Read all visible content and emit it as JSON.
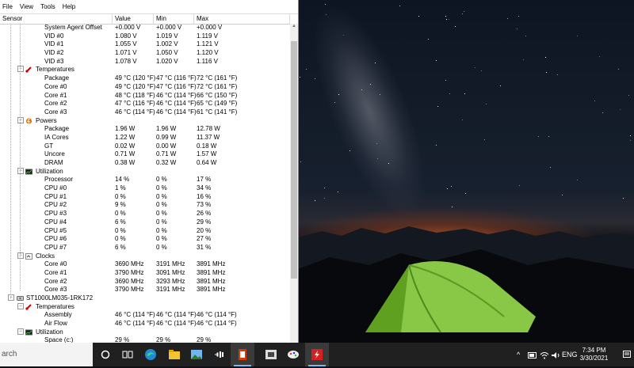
{
  "menu": [
    "File",
    "View",
    "Tools",
    "Help"
  ],
  "columns": {
    "sensor": "Sensor",
    "value": "Value",
    "min": "Min",
    "max": "Max"
  },
  "rows": [
    {
      "type": "item",
      "name": "System Agent Offset",
      "value": "+0.000 V",
      "min": "+0.000 V",
      "max": "+0.000 V"
    },
    {
      "type": "item",
      "name": "VID #0",
      "value": "1.080 V",
      "min": "1.019 V",
      "max": "1.119 V"
    },
    {
      "type": "item",
      "name": "VID #1",
      "value": "1.055 V",
      "min": "1.002 V",
      "max": "1.121 V"
    },
    {
      "type": "item",
      "name": "VID #2",
      "value": "1.071 V",
      "min": "1.050 V",
      "max": "1.120 V"
    },
    {
      "type": "item",
      "name": "VID #3",
      "value": "1.078 V",
      "min": "1.020 V",
      "max": "1.116 V"
    },
    {
      "type": "group",
      "name": "Temperatures",
      "icon": "thermometer-icon"
    },
    {
      "type": "item",
      "name": "Package",
      "value": "49 °C  (120 °F)",
      "min": "47 °C  (116 °F)",
      "max": "72 °C  (161 °F)"
    },
    {
      "type": "item",
      "name": "Core #0",
      "value": "49 °C  (120 °F)",
      "min": "47 °C  (116 °F)",
      "max": "72 °C  (161 °F)"
    },
    {
      "type": "item",
      "name": "Core #1",
      "value": "48 °C  (118 °F)",
      "min": "46 °C  (114 °F)",
      "max": "66 °C  (150 °F)"
    },
    {
      "type": "item",
      "name": "Core #2",
      "value": "47 °C  (116 °F)",
      "min": "46 °C  (114 °F)",
      "max": "65 °C  (149 °F)"
    },
    {
      "type": "item",
      "name": "Core #3",
      "value": "46 °C  (114 °F)",
      "min": "46 °C  (114 °F)",
      "max": "61 °C  (141 °F)"
    },
    {
      "type": "group",
      "name": "Powers",
      "icon": "power-icon"
    },
    {
      "type": "item",
      "name": "Package",
      "value": "1.96 W",
      "min": "1.96 W",
      "max": "12.78 W"
    },
    {
      "type": "item",
      "name": "IA Cores",
      "value": "1.22 W",
      "min": "0.99 W",
      "max": "11.37 W"
    },
    {
      "type": "item",
      "name": "GT",
      "value": "0.02 W",
      "min": "0.00 W",
      "max": "0.18 W"
    },
    {
      "type": "item",
      "name": "Uncore",
      "value": "0.71 W",
      "min": "0.71 W",
      "max": "1.57 W"
    },
    {
      "type": "item",
      "name": "DRAM",
      "value": "0.38 W",
      "min": "0.32 W",
      "max": "0.64 W"
    },
    {
      "type": "group",
      "name": "Utilization",
      "icon": "utilization-icon"
    },
    {
      "type": "item",
      "name": "Processor",
      "value": "14 %",
      "min": "0 %",
      "max": "17 %"
    },
    {
      "type": "item",
      "name": "CPU #0",
      "value": "1 %",
      "min": "0 %",
      "max": "34 %"
    },
    {
      "type": "item",
      "name": "CPU #1",
      "value": "0 %",
      "min": "0 %",
      "max": "16 %"
    },
    {
      "type": "item",
      "name": "CPU #2",
      "value": "9 %",
      "min": "0 %",
      "max": "73 %"
    },
    {
      "type": "item",
      "name": "CPU #3",
      "value": "0 %",
      "min": "0 %",
      "max": "26 %"
    },
    {
      "type": "item",
      "name": "CPU #4",
      "value": "6 %",
      "min": "0 %",
      "max": "29 %"
    },
    {
      "type": "item",
      "name": "CPU #5",
      "value": "0 %",
      "min": "0 %",
      "max": "20 %"
    },
    {
      "type": "item",
      "name": "CPU #6",
      "value": "0 %",
      "min": "0 %",
      "max": "27 %"
    },
    {
      "type": "item",
      "name": "CPU #7",
      "value": "6 %",
      "min": "0 %",
      "max": "31 %"
    },
    {
      "type": "group",
      "name": "Clocks",
      "icon": "clock-icon"
    },
    {
      "type": "item",
      "name": "Core #0",
      "value": "3690 MHz",
      "min": "3191 MHz",
      "max": "3891 MHz"
    },
    {
      "type": "item",
      "name": "Core #1",
      "value": "3790 MHz",
      "min": "3091 MHz",
      "max": "3891 MHz"
    },
    {
      "type": "item",
      "name": "Core #2",
      "value": "3690 MHz",
      "min": "3293 MHz",
      "max": "3891 MHz"
    },
    {
      "type": "item",
      "name": "Core #3",
      "value": "3790 MHz",
      "min": "3191 MHz",
      "max": "3891 MHz"
    },
    {
      "type": "device",
      "name": "ST1000LM035-1RK172",
      "icon": "hard-disk-icon"
    },
    {
      "type": "group",
      "name": "Temperatures",
      "icon": "thermometer-icon"
    },
    {
      "type": "item",
      "name": "Assembly",
      "value": "46 °C  (114 °F)",
      "min": "46 °C  (114 °F)",
      "max": "46 °C  (114 °F)"
    },
    {
      "type": "item",
      "name": "Air Flow",
      "value": "46 °C  (114 °F)",
      "min": "46 °C  (114 °F)",
      "max": "46 °C  (114 °F)"
    },
    {
      "type": "group",
      "name": "Utilization",
      "icon": "utilization-icon"
    },
    {
      "type": "item",
      "name": "Space (c:)",
      "value": "29 %",
      "min": "29 %",
      "max": "29 %"
    }
  ],
  "taskbar": {
    "search_text": "arch",
    "apps": [
      "cortana-icon",
      "task-view-icon",
      "edge-icon",
      "file-explorer-icon",
      "photos-icon",
      "media-player-icon",
      "office-icon",
      "remote-app-icon",
      "paint-icon",
      "open-hardware-monitor-icon"
    ],
    "tray": {
      "language": "ENG",
      "time": "7:34 PM",
      "date": "3/30/2021"
    }
  },
  "colors": {
    "accent": "#76b9ed",
    "taskbar": "#202020",
    "tent_green": "#7ec63a",
    "horizon_orange": "#e26a28"
  }
}
